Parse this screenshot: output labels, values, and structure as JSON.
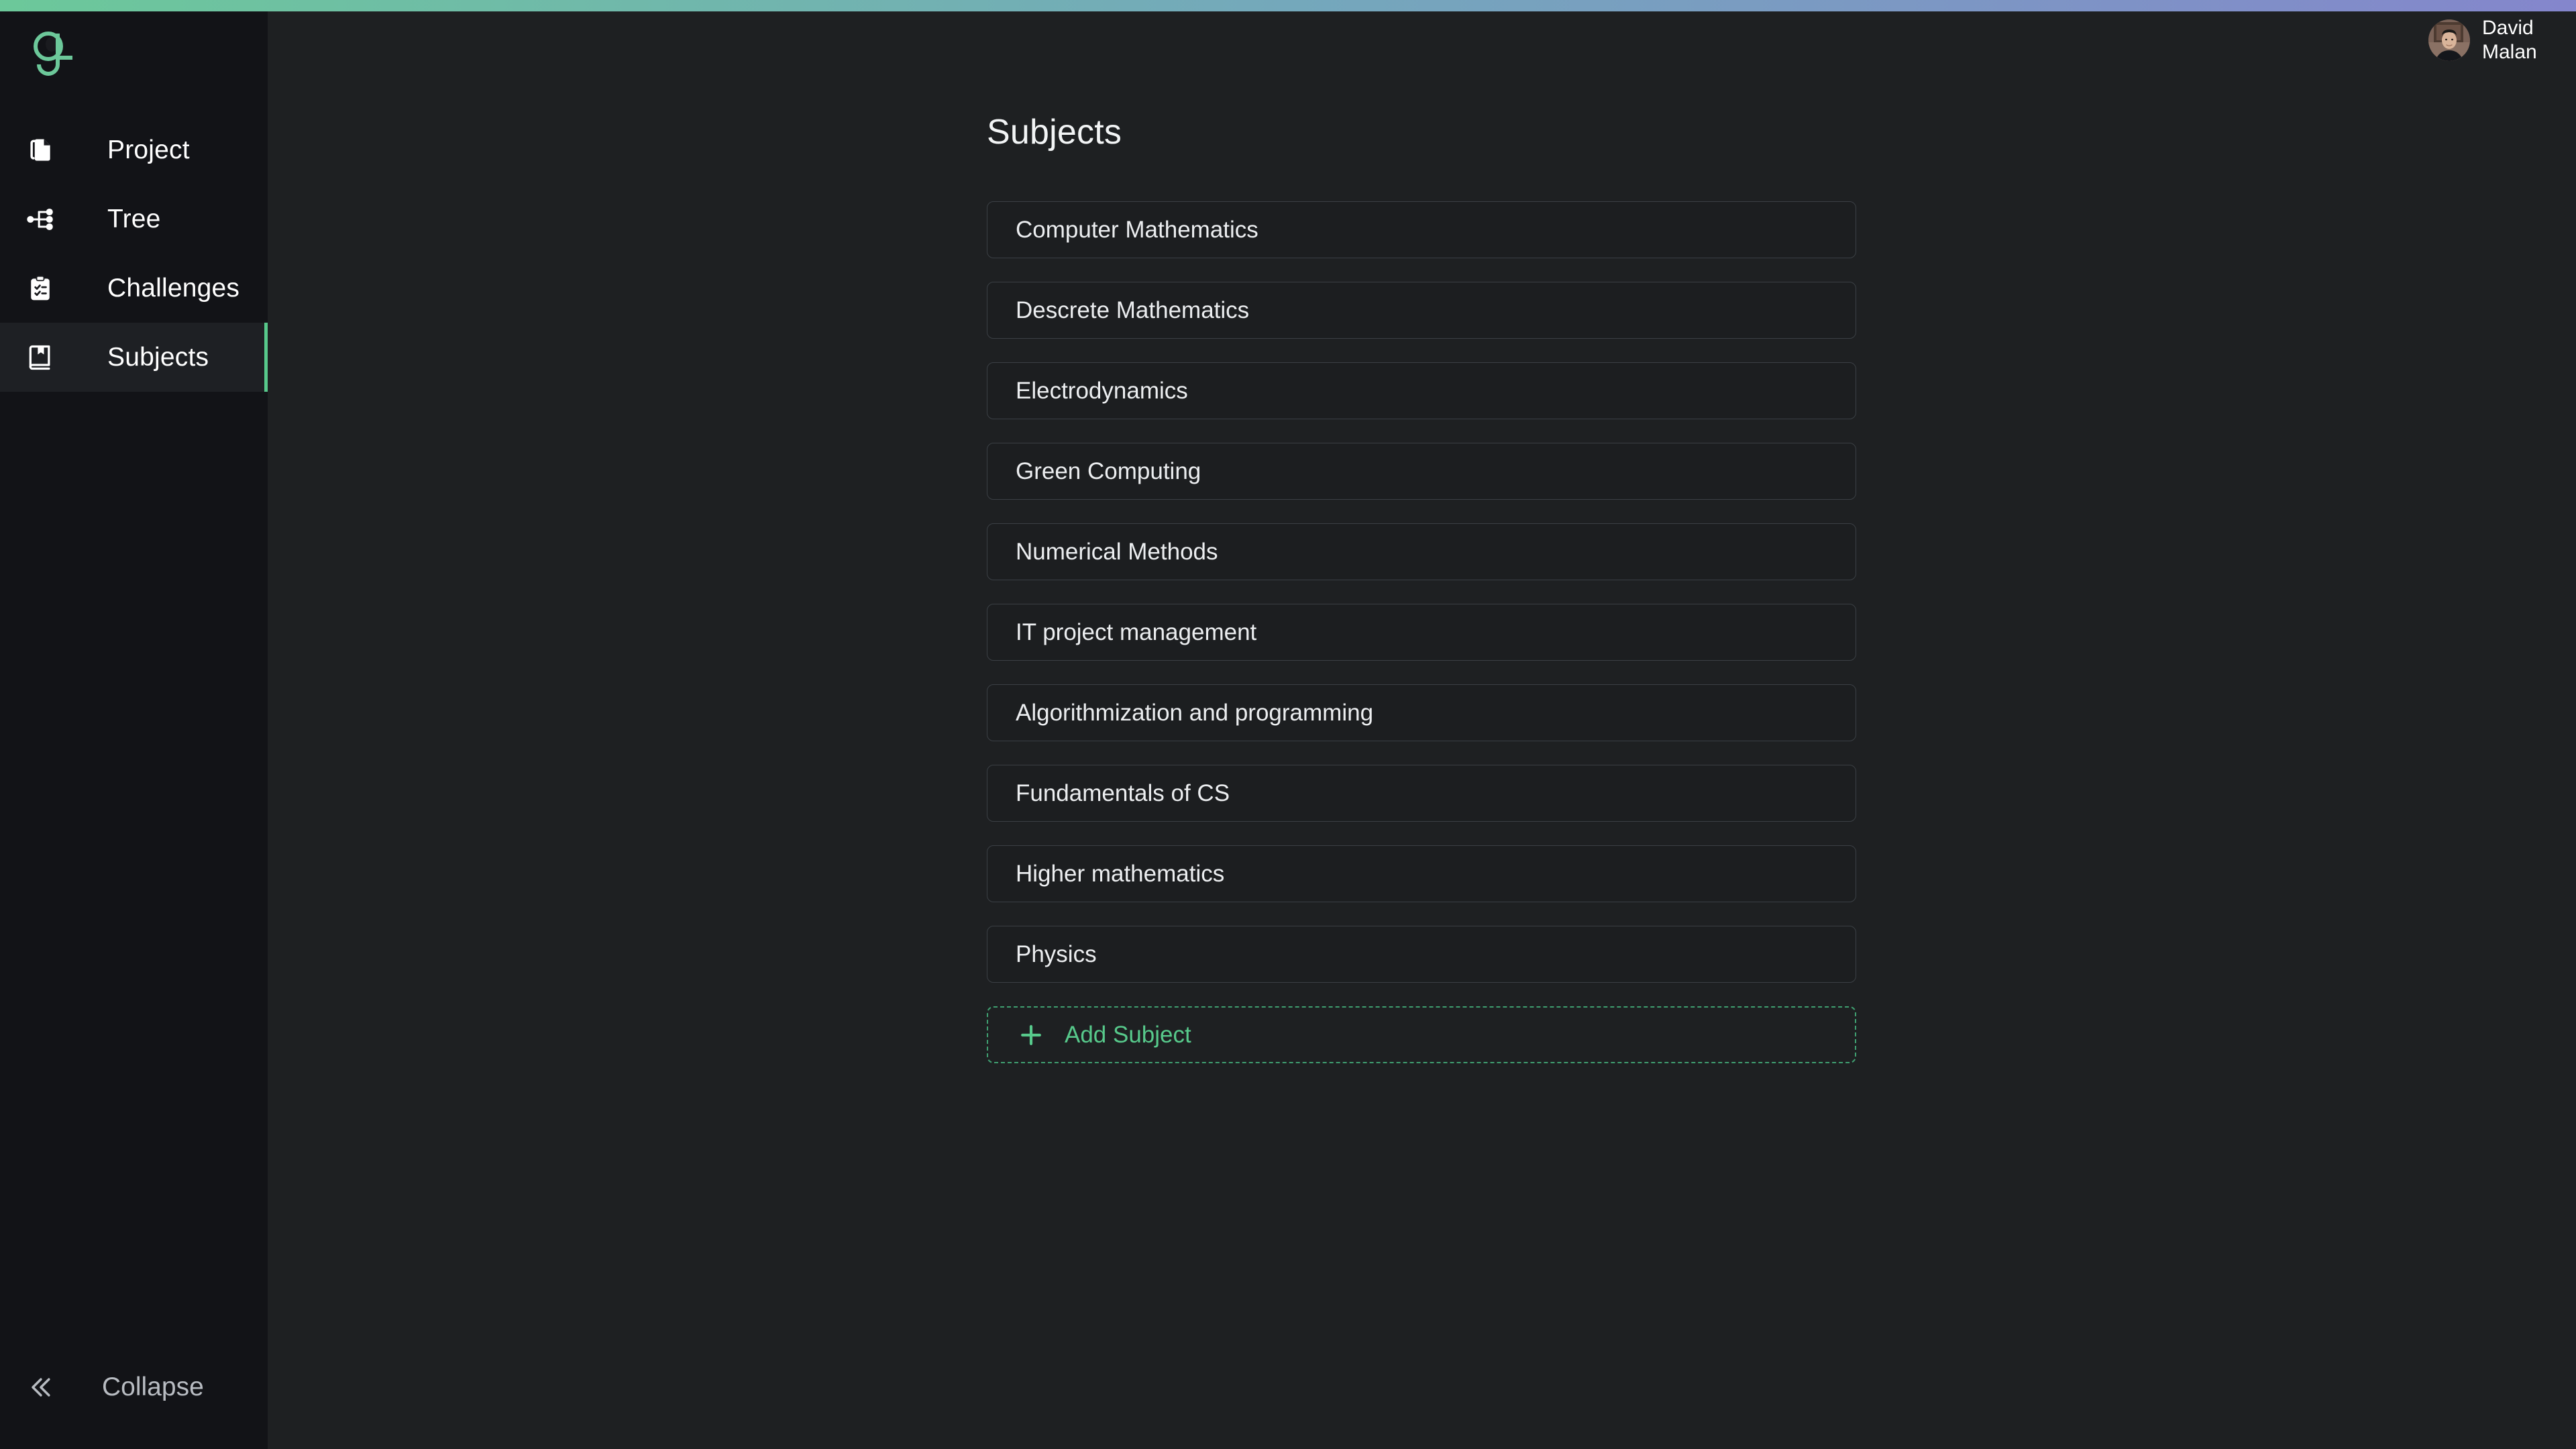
{
  "brand": {
    "logo_icon": "logo-g-icon",
    "accent_green": "#57c98b",
    "gradient_start": "#6cc89a",
    "gradient_mid": "#74a8bb",
    "gradient_end": "#8486cc"
  },
  "sidebar": {
    "items": [
      {
        "label": "Project",
        "icon": "files-copy-icon",
        "active": false
      },
      {
        "label": "Tree",
        "icon": "hierarchy-tree-icon",
        "active": false
      },
      {
        "label": "Challenges",
        "icon": "clipboard-check-icon",
        "active": false
      },
      {
        "label": "Subjects",
        "icon": "book-bookmark-icon",
        "active": true
      }
    ],
    "collapse": {
      "label": "Collapse",
      "icon": "chevrons-left-icon"
    }
  },
  "header": {
    "user": {
      "first_name": "David",
      "last_name": "Malan",
      "full_name": "David Malan",
      "avatar_icon": "user-avatar-photo"
    }
  },
  "main": {
    "title": "Subjects",
    "subjects": [
      {
        "name": "Computer Mathematics"
      },
      {
        "name": "Descrete Mathematics"
      },
      {
        "name": "Electrodynamics"
      },
      {
        "name": "Green Computing"
      },
      {
        "name": "Numerical Methods"
      },
      {
        "name": "IT project management"
      },
      {
        "name": "Algorithmization and programming"
      },
      {
        "name": "Fundamentals of CS"
      },
      {
        "name": "Higher mathematics"
      },
      {
        "name": "Physics"
      }
    ],
    "add_subject": {
      "label": "Add Subject",
      "icon": "plus-icon"
    }
  }
}
